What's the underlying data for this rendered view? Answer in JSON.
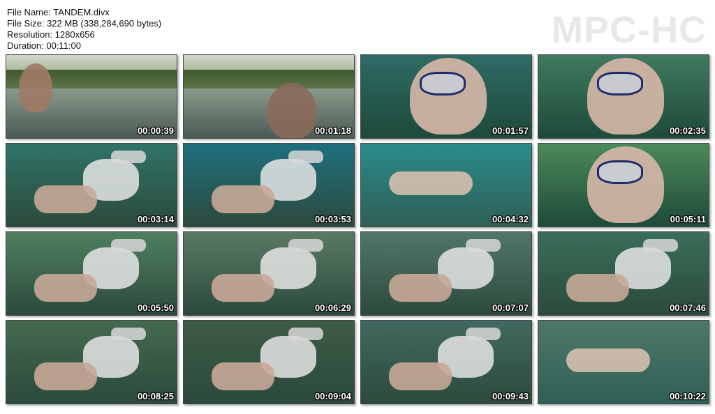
{
  "file_info": {
    "file_name": "File Name: TANDEM.divx",
    "file_size": "File Size: 322 MB (338,284,690 bytes)",
    "resolution": "Resolution: 1280x656",
    "duration": "Duration: 00:11:00"
  },
  "brand": "MPC-HC",
  "thumbnails": [
    {
      "time": "00:00:39",
      "scene": "surface",
      "bg": "#6f7a6c"
    },
    {
      "time": "00:01:18",
      "scene": "surface",
      "bg": "#7a7262"
    },
    {
      "time": "00:01:57",
      "scene": "closeup",
      "bg": "#2f6b66"
    },
    {
      "time": "00:02:35",
      "scene": "closeup",
      "bg": "#3f7a5e"
    },
    {
      "time": "00:03:14",
      "scene": "divers",
      "bg": "#2f7468"
    },
    {
      "time": "00:03:53",
      "scene": "divers",
      "bg": "#1f6f7f"
    },
    {
      "time": "00:04:32",
      "scene": "swimmer",
      "bg": "#2a8c8c"
    },
    {
      "time": "00:05:11",
      "scene": "closeup",
      "bg": "#4c8a58"
    },
    {
      "time": "00:05:50",
      "scene": "divers",
      "bg": "#4f7f60"
    },
    {
      "time": "00:06:29",
      "scene": "divers",
      "bg": "#5a7a65"
    },
    {
      "time": "00:07:07",
      "scene": "divers",
      "bg": "#51776a"
    },
    {
      "time": "00:07:46",
      "scene": "divers",
      "bg": "#3a6e5a"
    },
    {
      "time": "00:08:25",
      "scene": "divers",
      "bg": "#446a4f"
    },
    {
      "time": "00:09:04",
      "scene": "divers",
      "bg": "#3d5b46"
    },
    {
      "time": "00:09:43",
      "scene": "divers",
      "bg": "#41695f"
    },
    {
      "time": "00:10:22",
      "scene": "swimmer",
      "bg": "#4d7868"
    }
  ]
}
